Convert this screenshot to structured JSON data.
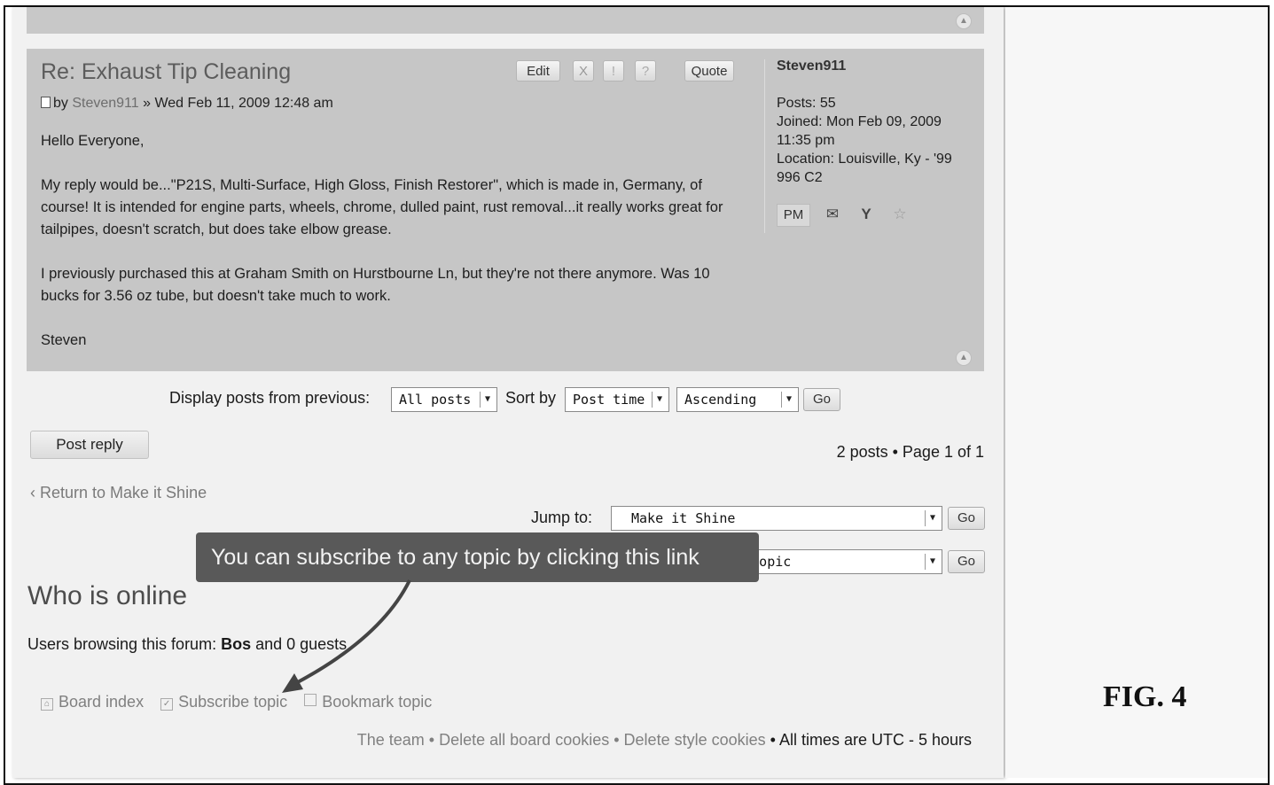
{
  "post": {
    "title": "Re: Exhaust Tip Cleaning",
    "buttons": {
      "edit": "Edit",
      "delete": "X",
      "report": "!",
      "info": "?",
      "quote": "Quote"
    },
    "byline_prefix": "by ",
    "author": "Steven911",
    "date": " » Wed Feb 11, 2009 12:48 am",
    "paragraphs": [
      "Hello Everyone,",
      "My reply would be...\"P21S, Multi-Surface, High Gloss, Finish Restorer\", which is made in, Germany, of course! It is intended for engine parts, wheels, chrome, dulled paint, rust removal...it really works great for tailpipes, doesn't scratch, but does take elbow grease.",
      "I previously purchased this at Graham Smith on Hurstbourne Ln, but they're not there anymore. Was 10 bucks for 3.56 oz tube, but doesn't take much to work.",
      "Steven"
    ]
  },
  "profile": {
    "username": "Steven911",
    "posts": "Posts: 55",
    "joined": "Joined: Mon Feb 09, 2009 11:35 pm",
    "location": "Location: Louisville, Ky - '99 996 C2",
    "pm_label": "PM",
    "icons": [
      "email-icon",
      "yahoo-icon",
      "aim-icon"
    ]
  },
  "display": {
    "label": "Display posts from previous:",
    "posts_value": "All posts",
    "sort_label": "Sort by",
    "sort_value": "Post time",
    "order_value": "Ascending",
    "go": "Go"
  },
  "post_reply": "Post reply",
  "pagination": "2 posts • Page 1 of 1",
  "return_link": "‹ Return to Make it Shine",
  "jump": {
    "label": "Jump to:",
    "value": "Make it Shine",
    "go": "Go"
  },
  "quick_mod": {
    "value": "...k topic",
    "go": "Go"
  },
  "tooltip": "You can subscribe to any topic by clicking this link",
  "who_is_online": {
    "heading": "Who is online",
    "prefix": "Users browsing this forum: ",
    "user": "Bos",
    "suffix": " and 0 guests"
  },
  "footer_links": [
    "Board index",
    "Subscribe topic",
    "Bookmark topic"
  ],
  "bottom": {
    "team": "The team",
    "sep": " • ",
    "delete_cookies": "Delete all board cookies",
    "delete_style": "Delete style cookies",
    "timezone": "All times are UTC - 5 hours"
  },
  "figure_label": "FIG. 4"
}
